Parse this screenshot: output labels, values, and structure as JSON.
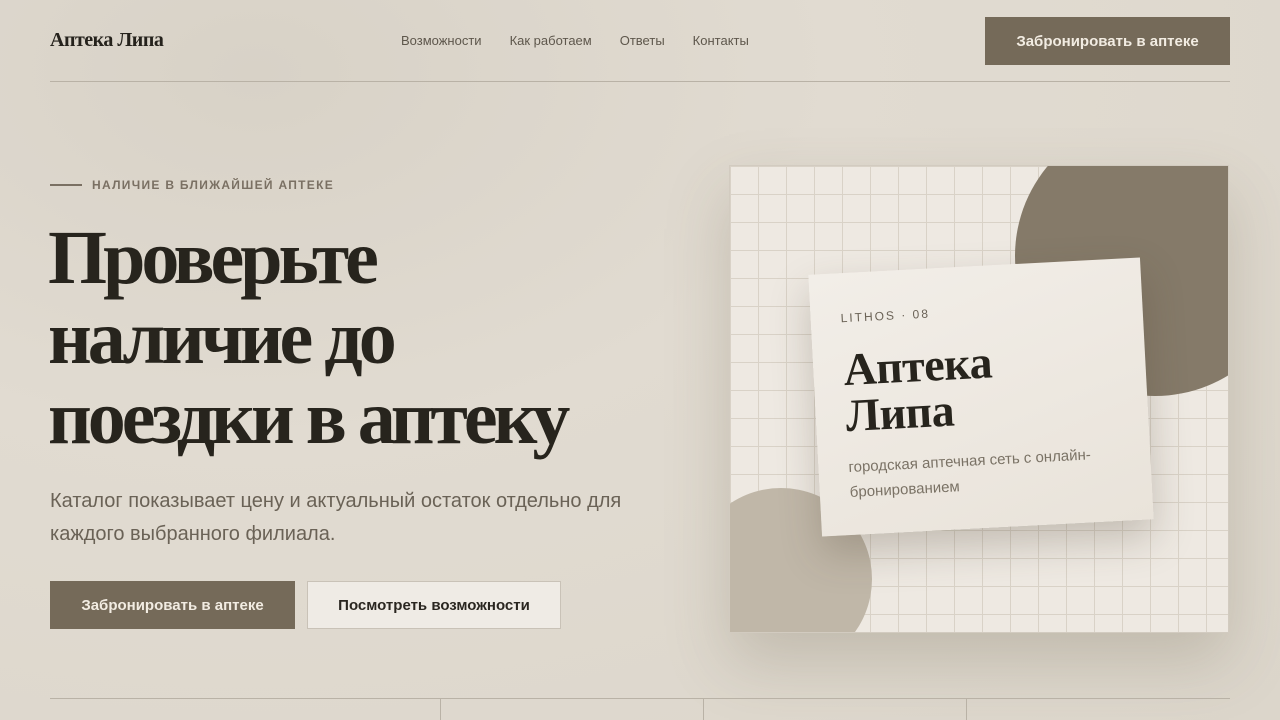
{
  "header": {
    "logo": "Аптека Липа",
    "nav": [
      "Возможности",
      "Как работаем",
      "Ответы",
      "Контакты"
    ],
    "cta_label": "Забронировать в аптеке"
  },
  "hero": {
    "eyebrow": "НАЛИЧИЕ В БЛИЖАЙШЕЙ АПТЕКЕ",
    "title_lines": [
      "Проверьте",
      "наличие до",
      "поездки в аптеку"
    ],
    "description": "Каталог показывает цену и актуальный остаток отдельно для каждого выбранного филиала.",
    "primary_label": "Забронировать в аптеке",
    "secondary_label": "Посмотреть возможности"
  },
  "card": {
    "tag": "LITHOS · 08",
    "title_lines": [
      "Аптека",
      "Липа"
    ],
    "subtitle": "городская аптечная сеть с онлайн-бронированием"
  },
  "colors": {
    "accent": "#756a59",
    "background": "#e1dbd1",
    "text": "#27241d"
  }
}
